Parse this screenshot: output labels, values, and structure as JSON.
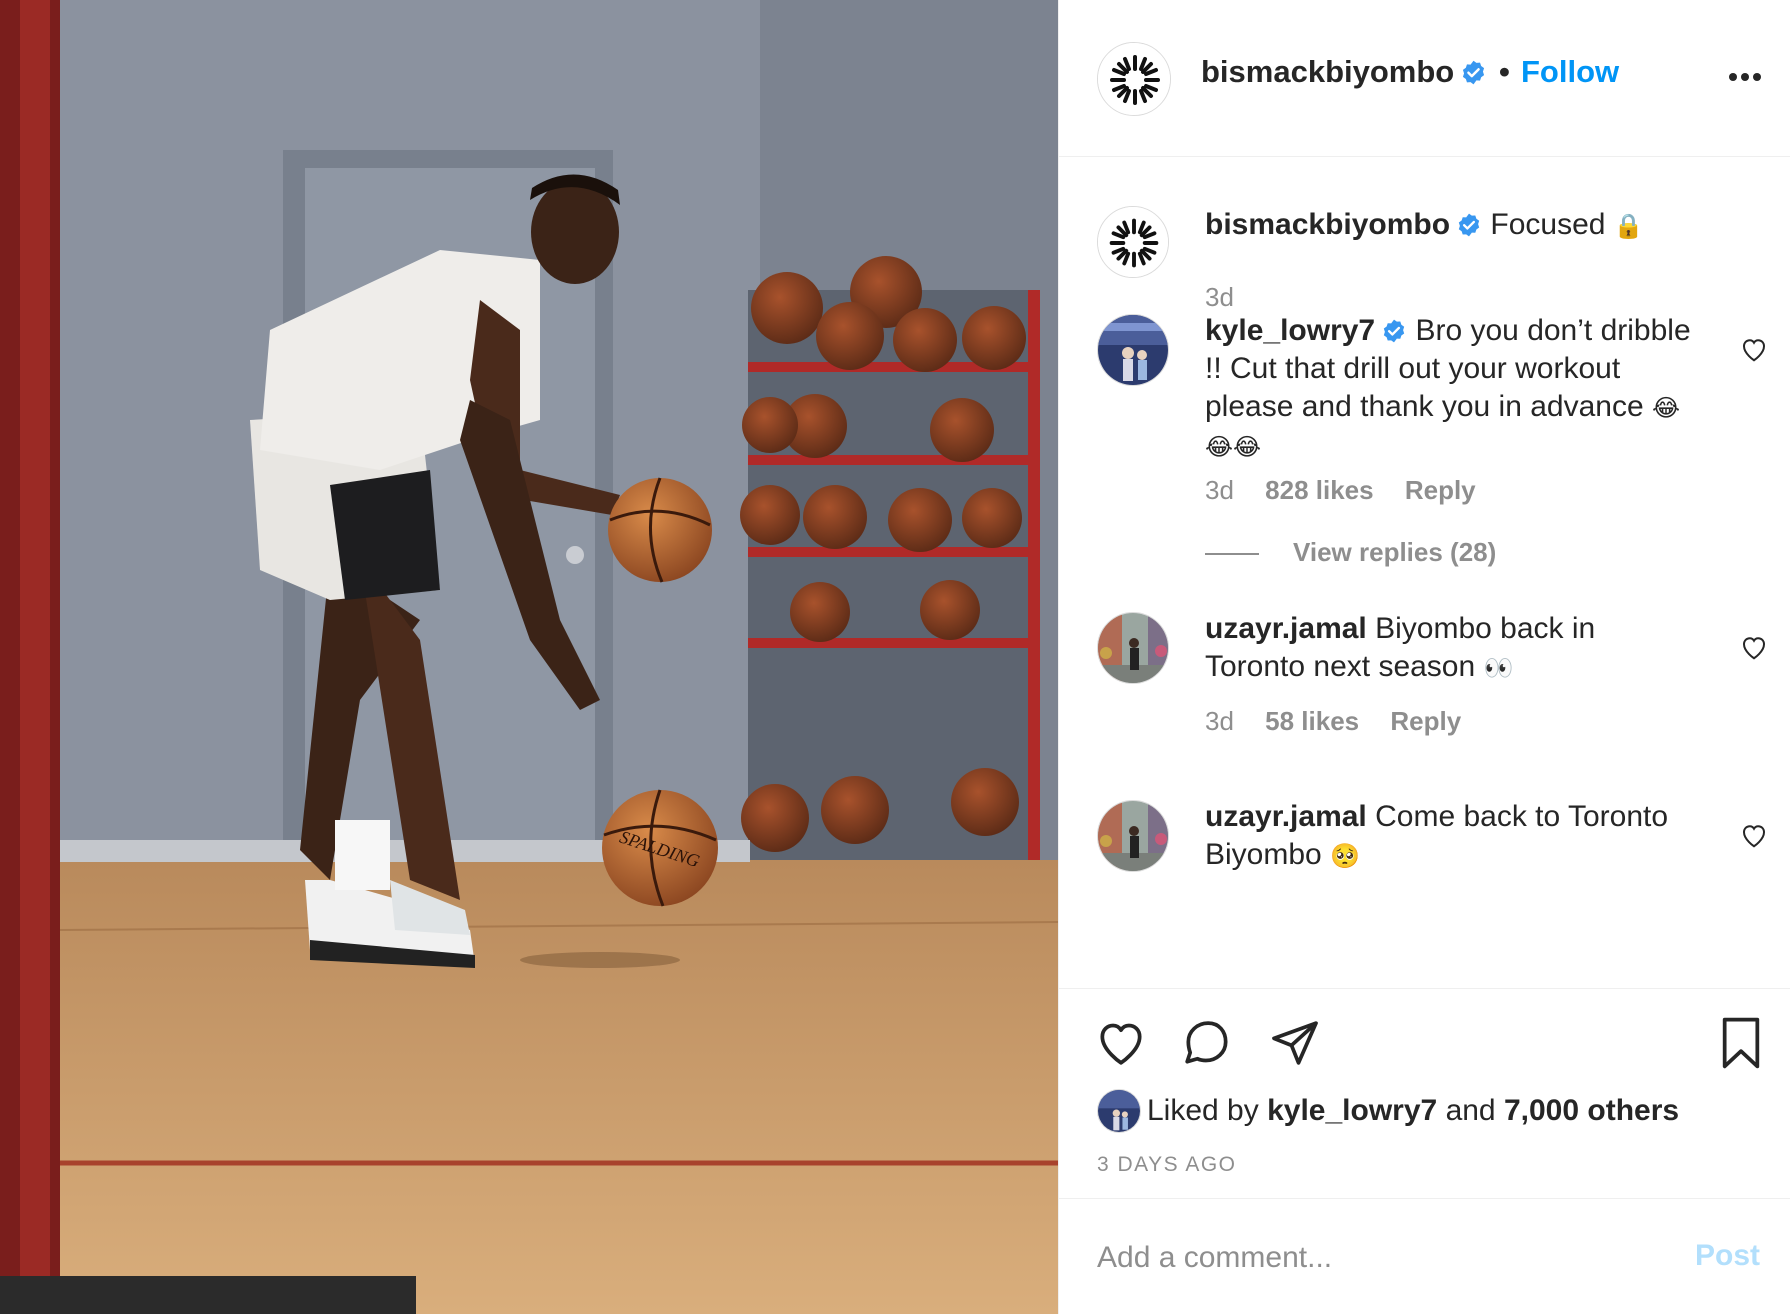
{
  "post": {
    "image_alt": "Player dribbling two basketballs in a gym",
    "image_ball_brand": "SPALDING"
  },
  "header": {
    "username": "bismackbiyombo",
    "separator": "•",
    "follow_label": "Follow",
    "more_icon": "more-horizontal-icon"
  },
  "caption": {
    "username": "bismackbiyombo",
    "text": "Focused",
    "emoji": "🔒",
    "time": "3d"
  },
  "comments": [
    {
      "username": "kyle_lowry7",
      "verified": true,
      "text": "Bro you don’t dribble !! Cut that drill out your workout please and thank you in advance",
      "emoji": "😂😂😂",
      "time": "3d",
      "likes": "828 likes",
      "reply_label": "Reply",
      "view_replies": "View replies (28)"
    },
    {
      "username": "uzayr.jamal",
      "verified": false,
      "text": "Biyombo back in Toronto next season",
      "emoji": "👀",
      "time": "3d",
      "likes": "58 likes",
      "reply_label": "Reply"
    },
    {
      "username": "uzayr.jamal",
      "verified": false,
      "text": "Come back to Toronto Biyombo",
      "emoji": "🥺",
      "time": "",
      "likes": "",
      "reply_label": ""
    }
  ],
  "actions": {
    "like_icon": "heart-icon",
    "comment_icon": "comment-icon",
    "share_icon": "send-icon",
    "save_icon": "bookmark-icon",
    "liked_by_prefix": "Liked by",
    "liked_by_user": "kyle_lowry7",
    "liked_by_and": "and",
    "liked_by_others": "7,000 others",
    "timestamp": "3 DAYS AGO"
  },
  "add_comment": {
    "placeholder": "Add a comment...",
    "post_label": "Post"
  },
  "colors": {
    "link_blue": "#0095f6",
    "post_disabled": "#b2dffc",
    "muted": "#8e8e8e",
    "text": "#262626",
    "verified": "#3897f0"
  }
}
